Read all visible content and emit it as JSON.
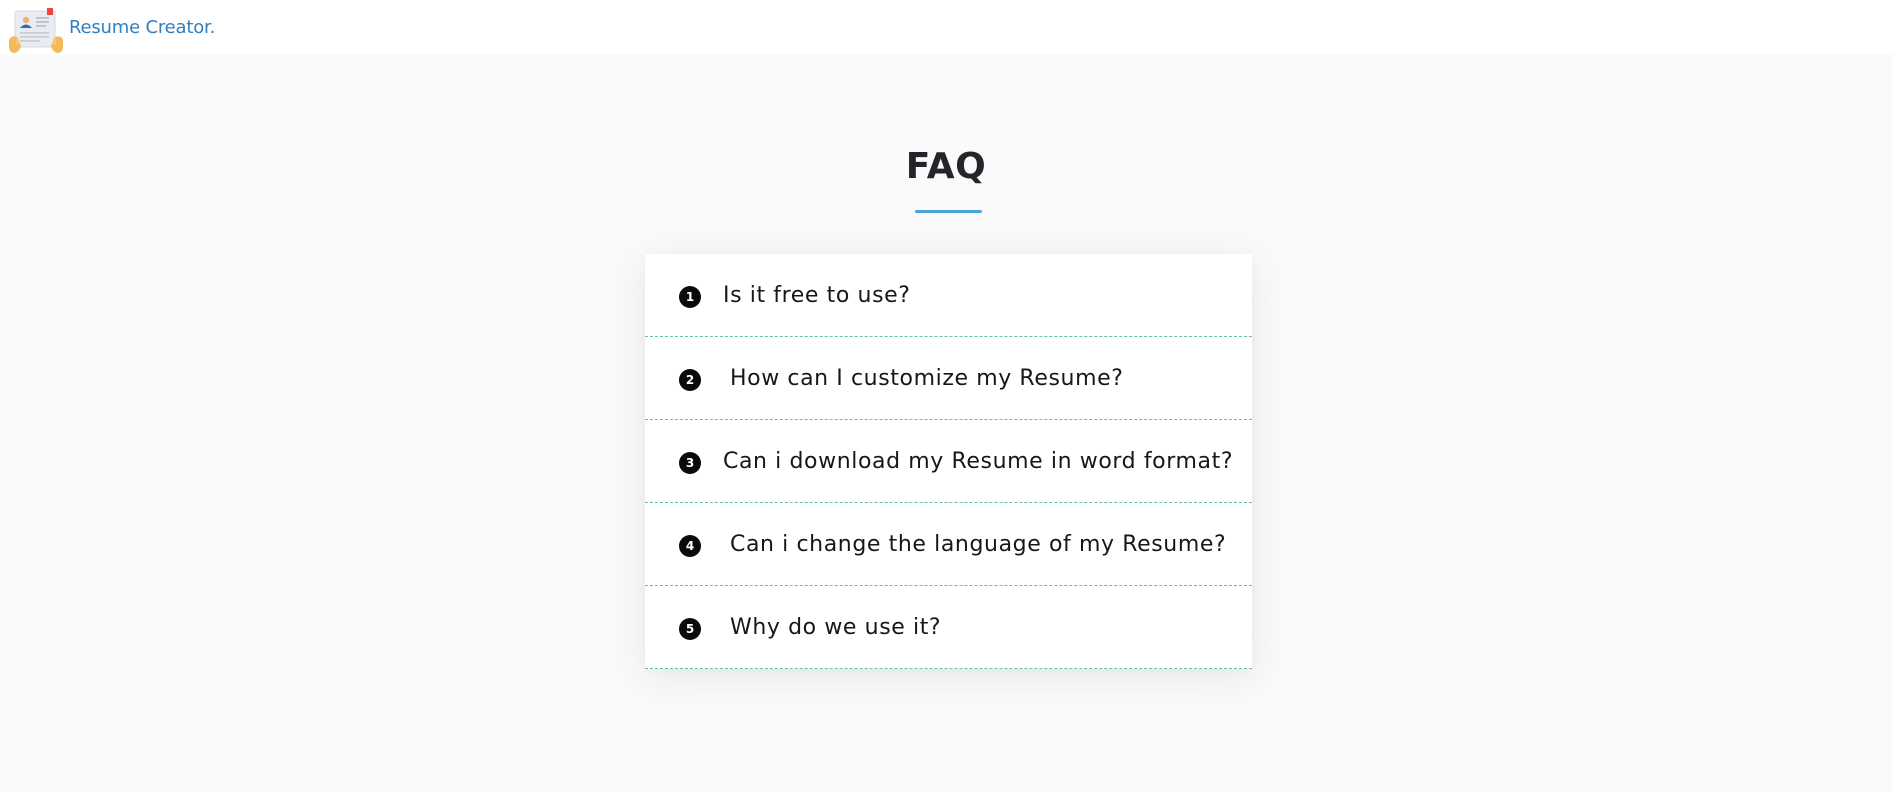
{
  "header": {
    "brand_name": "Resume Creator."
  },
  "main": {
    "title": "FAQ",
    "faq_items": [
      {
        "number": "1",
        "question": "Is it free to use?"
      },
      {
        "number": "2",
        "question": "How can I customize my Resume?"
      },
      {
        "number": "3",
        "question": "Can i download my Resume in word format?"
      },
      {
        "number": "4",
        "question": "Can i change the language of my Resume?"
      },
      {
        "number": "5",
        "question": "Why do we use it?"
      }
    ]
  },
  "colors": {
    "brand_text": "#2f7fc1",
    "title_underline": "#4aa3d6",
    "item_divider": "#64c2a6",
    "page_background": "#fafafa"
  },
  "icons": {
    "logo": "resume-document-in-hands-icon"
  }
}
